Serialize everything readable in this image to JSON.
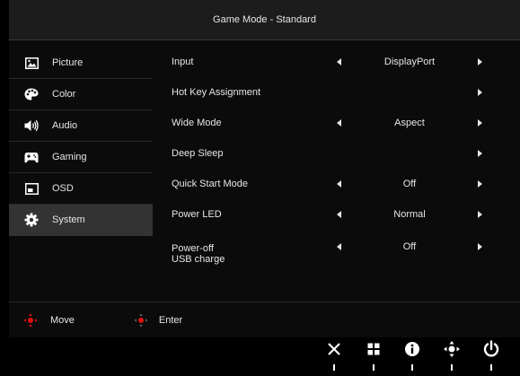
{
  "title": "Game Mode - Standard",
  "sidebar": {
    "items": [
      {
        "label": "Picture",
        "icon": "picture-icon"
      },
      {
        "label": "Color",
        "icon": "palette-icon"
      },
      {
        "label": "Audio",
        "icon": "speaker-icon"
      },
      {
        "label": "Gaming",
        "icon": "gamepad-icon"
      },
      {
        "label": "OSD",
        "icon": "osd-icon"
      },
      {
        "label": "System",
        "icon": "gear-icon",
        "selected": true
      }
    ]
  },
  "settings": [
    {
      "label": "Input",
      "value": "DisplayPort"
    },
    {
      "label": "Hot Key Assignment",
      "value": ""
    },
    {
      "label": "Wide Mode",
      "value": "Aspect"
    },
    {
      "label": "Deep Sleep",
      "value": ""
    },
    {
      "label": "Quick Start Mode",
      "value": "Off"
    },
    {
      "label": "Power LED",
      "value": "Normal"
    },
    {
      "label": "Power-off\nUSB charge",
      "value": "Off"
    }
  ],
  "footer": {
    "move_label": "Move",
    "enter_label": "Enter"
  },
  "buttons": [
    "close-icon",
    "menu-grid-icon",
    "info-icon",
    "joystick-icon",
    "power-icon"
  ],
  "colors": {
    "background": "#000000",
    "panel": "#0b0b0b",
    "selected": "#333333",
    "accent_red": "#e01010"
  }
}
